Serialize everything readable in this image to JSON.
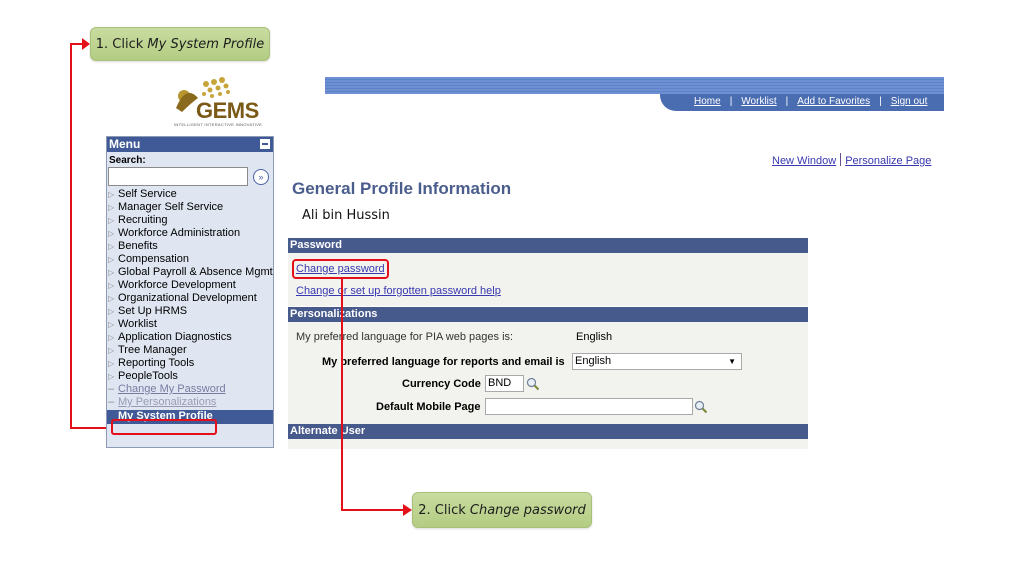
{
  "callouts": {
    "step1": {
      "prefix": "1. Click ",
      "emphasis": "My System Profile"
    },
    "step2": {
      "prefix": "2. Click ",
      "emphasis": "Change password"
    }
  },
  "logo": {
    "text": "GEMS",
    "tagline": "INTELLIGENT  INTERACTIVE  INNOVATIVE"
  },
  "menu": {
    "title": "Menu",
    "search_label": "Search:",
    "search_value": "",
    "search_go_icon": "»",
    "items": [
      {
        "label": "Self Service",
        "type": "folder"
      },
      {
        "label": "Manager Self Service",
        "type": "folder"
      },
      {
        "label": "Recruiting",
        "type": "folder"
      },
      {
        "label": "Workforce Administration",
        "type": "folder"
      },
      {
        "label": "Benefits",
        "type": "folder"
      },
      {
        "label": "Compensation",
        "type": "folder"
      },
      {
        "label": "Global Payroll & Absence Mgmt",
        "type": "folder"
      },
      {
        "label": "Workforce Development",
        "type": "folder"
      },
      {
        "label": "Organizational Development",
        "type": "folder"
      },
      {
        "label": "Set Up HRMS",
        "type": "folder"
      },
      {
        "label": "Worklist",
        "type": "folder"
      },
      {
        "label": "Application Diagnostics",
        "type": "folder"
      },
      {
        "label": "Tree Manager",
        "type": "folder"
      },
      {
        "label": "Reporting Tools",
        "type": "folder"
      },
      {
        "label": "PeopleTools",
        "type": "folder"
      },
      {
        "label": "Change My Password",
        "type": "link"
      },
      {
        "label": "My Personalizations",
        "type": "link"
      },
      {
        "label": "My System Profile",
        "type": "selected"
      }
    ]
  },
  "topnav": {
    "links": [
      "Home",
      "Worklist",
      "Add to Favorites",
      "Sign out"
    ],
    "separator": "|"
  },
  "pagelinks": {
    "new_window": "New Window",
    "personalize": "Personalize Page"
  },
  "page": {
    "title": "General Profile Information",
    "user_name": "Ali bin Hussin"
  },
  "sections": {
    "password": {
      "title": "Password",
      "change_password": "Change password",
      "forgot_help": "Change or set up forgotten password help"
    },
    "personalizations": {
      "title": "Personalizations",
      "pia_label": "My preferred language for PIA web pages is:",
      "pia_value": "English",
      "report_lang_label": "My preferred language for reports and email is",
      "report_lang_value": "English",
      "currency_label": "Currency Code",
      "currency_value": "BND",
      "mobile_label": "Default Mobile Page",
      "mobile_value": ""
    },
    "alternate_user": {
      "title": "Alternate User"
    }
  },
  "colors": {
    "highlight_red": "#e3101a",
    "callout_green": "#b9d08a",
    "section_header": "#475a8c",
    "link_blue": "#3838b0"
  }
}
